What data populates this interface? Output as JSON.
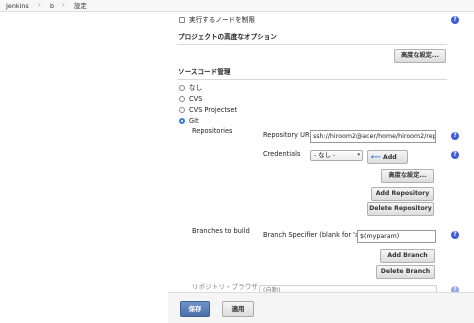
{
  "breadcrumb": {
    "items": [
      "Jenkins",
      "b",
      "設定"
    ],
    "separator": "›"
  },
  "execute": {
    "label": "実行するノードを制限"
  },
  "advanced_project": {
    "heading": "プロジェクトの高度なオプション",
    "button": "高度な設定..."
  },
  "scm": {
    "heading": "ソースコード管理",
    "options": [
      "なし",
      "CVS",
      "CVS Projectset",
      "Git"
    ],
    "selected": "Git",
    "repositories_label": "Repositories",
    "repository_url_label": "Repository URL",
    "repository_url_value": "ssh://hiroom2@acer/home/hiroom2/repo/mer",
    "credentials_label": "Credentials",
    "credentials_value": "- なし -",
    "add_label": "Add",
    "advanced_button": "高度な設定...",
    "add_repository": "Add Repository",
    "delete_repository": "Delete Repository",
    "branches_label": "Branches to build",
    "branch_specifier_label": "Branch Specifier (blank for 'any')",
    "branch_specifier_value": "$(myparam)",
    "add_branch": "Add Branch",
    "delete_branch": "Delete Branch",
    "browser_label": "リポジトリ・ブラウザ",
    "browser_value": "(自動)"
  },
  "footer": {
    "save": "保存",
    "apply": "適用"
  },
  "icons": {
    "help": "help-icon",
    "add": "add-key-icon",
    "dropdown": "chevron-down-icon"
  },
  "colors": {
    "help": "#3b5bdb",
    "save": "#4a6fa9",
    "radio_selected": "#3a7bd5"
  }
}
